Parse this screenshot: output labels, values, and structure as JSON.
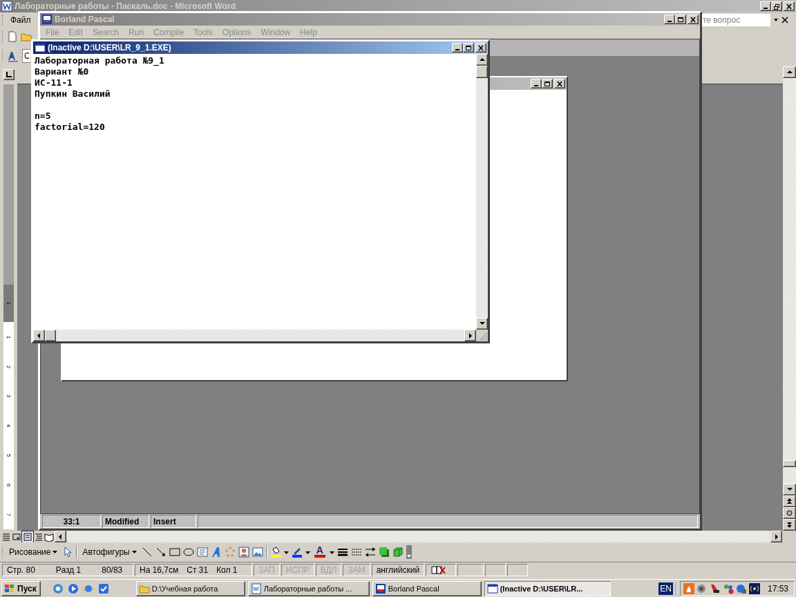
{
  "word": {
    "title": "Лабораторные работы - Паскаль.doc - Microsoft Word",
    "menu": [
      {
        "label": "Файл"
      }
    ],
    "help_box": {
      "placeholder": "те вопрос"
    },
    "style_box": {
      "value": "С"
    },
    "ruler_labels": [
      "1",
      "1",
      "2",
      "3",
      "4",
      "5",
      "6",
      "7"
    ],
    "drawing_toolbar": {
      "draw_menu": "Рисование",
      "autoshapes_menu": "Автофигуры",
      "font_color": "A"
    },
    "status": {
      "page": "Стр. 80",
      "section": "Разд 1",
      "pages": "80/83",
      "position": "На 16,7см",
      "line": "Ст 31",
      "column": "Кол 1",
      "modes": [
        {
          "label": "ЗАП",
          "disabled": true
        },
        {
          "label": "ИСПР",
          "disabled": true
        },
        {
          "label": "ВДЛ",
          "disabled": true
        },
        {
          "label": "ЗАМ",
          "disabled": true
        }
      ],
      "language": "английский"
    }
  },
  "borland": {
    "title": "Borland Pascal",
    "menu": [
      {
        "label": "File",
        "disabled": true
      },
      {
        "label": "Edit",
        "disabled": true
      },
      {
        "label": "Search",
        "disabled": true
      },
      {
        "label": "Run",
        "disabled": true
      },
      {
        "label": "Compile",
        "disabled": true
      },
      {
        "label": "Tools",
        "disabled": true
      },
      {
        "label": "Options",
        "disabled": true
      },
      {
        "label": "Window",
        "disabled": true
      },
      {
        "label": "Help",
        "disabled": true
      }
    ],
    "status": [
      "33:1",
      "Modified",
      "Insert"
    ]
  },
  "dos_window": {
    "title": "(Inactive D:\\USER\\LR_9_1.EXE)",
    "output_blocks": [
      [
        "Лабораторная работа №9_1",
        "Вариант №0",
        "ИС-11-1",
        "Пупкин Василий"
      ],
      [
        "n=5",
        "factorial=120"
      ]
    ]
  },
  "taskbar": {
    "start": "Пуск",
    "tasks": [
      {
        "label": "D:\\Учебная работа",
        "kind": "folder",
        "selected": false
      },
      {
        "label": "Лабораторные работы ...",
        "kind": "word",
        "selected": false
      },
      {
        "label": "Borland Pascal",
        "kind": "bpw",
        "selected": false
      },
      {
        "label": "(Inactive D:\\USER\\LR...",
        "kind": "window",
        "selected": true
      }
    ],
    "language": "EN",
    "clock": "17:53"
  }
}
